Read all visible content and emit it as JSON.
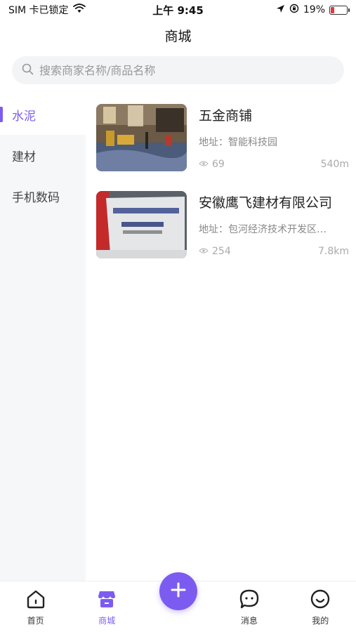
{
  "status_bar": {
    "carrier": "SIM 卡已锁定",
    "time": "上午 9:45",
    "battery": "19%",
    "battery_level": 0.19,
    "icons": [
      "wifi-icon",
      "location-arrow-icon",
      "orientation-lock-icon",
      "battery-icon"
    ]
  },
  "header": {
    "title": "商城"
  },
  "search": {
    "placeholder": "搜索商家名称/商品名称"
  },
  "sidebar": {
    "items": [
      {
        "label": "水泥",
        "active": true
      },
      {
        "label": "建材",
        "active": false
      },
      {
        "label": "手机数码",
        "active": false
      }
    ]
  },
  "stores": [
    {
      "name": "五金商铺",
      "address": "地址：智能科技园",
      "views": "69",
      "distance": "540m"
    },
    {
      "name": "安徽鹰飞建材有限公司",
      "address": "地址：包河经济技术开发区…",
      "views": "254",
      "distance": "7.8km"
    }
  ],
  "tabbar": {
    "items": [
      {
        "label": "首页",
        "icon": "home-icon",
        "active": false
      },
      {
        "label": "商城",
        "icon": "shop-icon",
        "active": true
      },
      {
        "label": "",
        "icon": "plus-icon",
        "active": false
      },
      {
        "label": "消息",
        "icon": "chat-icon",
        "active": false
      },
      {
        "label": "我的",
        "icon": "smile-icon",
        "active": false
      }
    ]
  },
  "colors": {
    "accent": "#7c5cf0",
    "battery_low": "#e0393e"
  }
}
